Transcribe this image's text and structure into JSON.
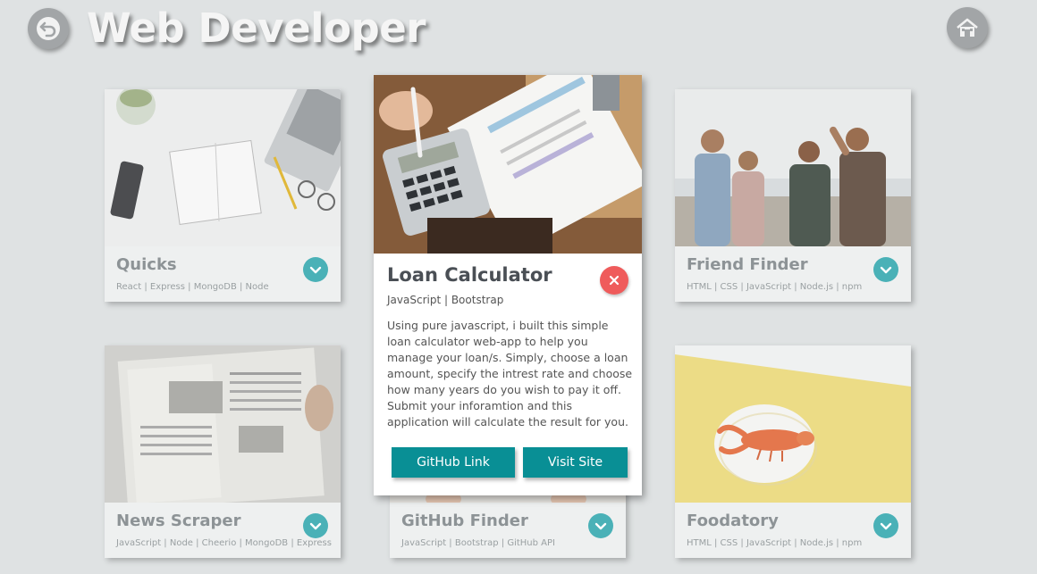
{
  "header": {
    "title": "Web Developer",
    "back_icon": "back-arrow-icon",
    "home_icon": "home-icon"
  },
  "projects": [
    {
      "title": "Quicks",
      "tags": "React | Express | MongoDB | Node"
    },
    {
      "title": "Friend Finder",
      "tags": "HTML | CSS | JavaScript | Node.js | npm"
    },
    {
      "title": "News Scraper",
      "tags": "JavaScript | Node | Cheerio | MongoDB | Express"
    },
    {
      "title": "GitHub Finder",
      "tags": "JavaScript | Bootstrap | GitHub API"
    },
    {
      "title": "Foodatory",
      "tags": "HTML | CSS | JavaScript | Node.js | npm"
    }
  ],
  "modal": {
    "title": "Loan Calculator",
    "tags": "JavaScript | Bootstrap",
    "description": "Using pure javascript, i built this simple loan calculator web-app to help you manage your loan/s. Simply, choose a loan amount, specify the intrest rate and choose how many years do you wish to pay it off. Submit your inforamtion and this application will calculate the result for you.",
    "github_label": "GitHub Link",
    "visit_label": "Visit Site",
    "close_icon": "close-icon"
  },
  "colors": {
    "background": "#dfe2e3",
    "accent_teal": "#4ab1b7",
    "button_teal": "#098f95",
    "close_red": "#ef5b5b"
  }
}
